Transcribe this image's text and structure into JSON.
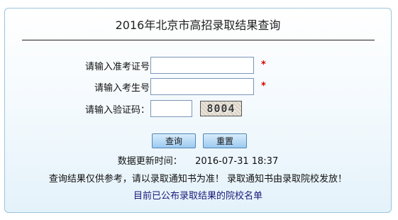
{
  "page": {
    "title": "2016年北京市高招录取结果查询"
  },
  "form": {
    "ticket_label": "请输入准考证号",
    "ticket_value": "",
    "student_label": "请输入考生号",
    "student_value": "",
    "captcha_label": "请输入验证码：",
    "captcha_value": "",
    "captcha_image_text": "8004",
    "required_mark": "*"
  },
  "buttons": {
    "query_label": "查询",
    "reset_label": "重置"
  },
  "info": {
    "updated_label": "数据更新时间：",
    "updated_value": "2016-07-31 18:37",
    "notice": "查询结果仅供参考，请以录取通知书为准！ 录取通知书由录取院校发放！",
    "link_text": "目前已公布录取结果的院校名单"
  },
  "colors": {
    "required": "#d40000",
    "border": "#9cc4dc",
    "button": "#9ccaf0"
  }
}
